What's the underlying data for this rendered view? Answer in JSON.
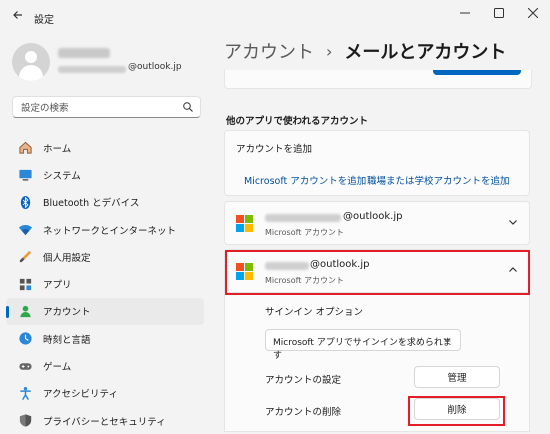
{
  "window": {
    "title": "設定"
  },
  "profile": {
    "email_suffix": "@outlook.jp"
  },
  "search": {
    "placeholder": "設定の検索"
  },
  "nav": {
    "items": [
      {
        "label": "ホーム",
        "icon": "home-icon"
      },
      {
        "label": "システム",
        "icon": "system-icon"
      },
      {
        "label": "Bluetooth とデバイス",
        "icon": "bluetooth-icon"
      },
      {
        "label": "ネットワークとインターネット",
        "icon": "network-icon"
      },
      {
        "label": "個人用設定",
        "icon": "personalization-icon"
      },
      {
        "label": "アプリ",
        "icon": "apps-icon"
      },
      {
        "label": "アカウント",
        "icon": "accounts-icon",
        "active": true
      },
      {
        "label": "時刻と言語",
        "icon": "time-language-icon"
      },
      {
        "label": "ゲーム",
        "icon": "gaming-icon"
      },
      {
        "label": "アクセシビリティ",
        "icon": "accessibility-icon"
      },
      {
        "label": "プライバシーとセキュリティ",
        "icon": "privacy-icon"
      }
    ]
  },
  "breadcrumb": {
    "parent": "アカウント",
    "separator": "›",
    "current": "メールとアカウント"
  },
  "section": {
    "title": "他のアプリで使われるアカウント"
  },
  "add_account": {
    "header": "アカウントを追加",
    "link_microsoft": "Microsoft アカウントを追加",
    "link_work": "職場または学校アカウントを追加"
  },
  "accounts": [
    {
      "email_suffix": "@outlook.jp",
      "type": "Microsoft アカウント",
      "expanded": false
    },
    {
      "email_suffix": "@outlook.jp",
      "type": "Microsoft アカウント",
      "expanded": true
    }
  ],
  "expanded": {
    "signin_label": "サインイン オプション",
    "signin_value": "Microsoft アプリでサインインを求められます",
    "settings_label": "アカウントの設定",
    "manage_button": "管理",
    "remove_label": "アカウントの削除",
    "remove_button": "削除"
  },
  "colors": {
    "accent": "#0067c0",
    "highlight": "#e21f26"
  }
}
